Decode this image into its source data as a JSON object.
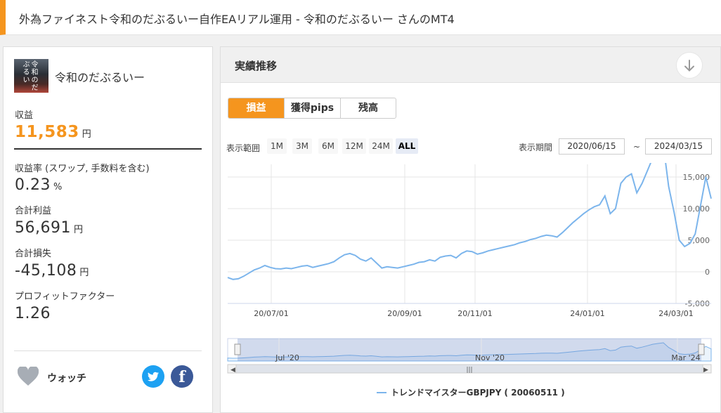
{
  "header": {
    "title": "外為ファイネスト令和のだぶるいー自作EAリアル運用 - 令和のだぶるいー さんのMT4"
  },
  "profile": {
    "name": "令和のだぶるいー",
    "avatar_text": "令和のだぶるい"
  },
  "stats": {
    "profit_label": "収益",
    "profit_value": "11,583",
    "yen": "円",
    "rate_label": "収益率 (スワップ, 手数料を含む)",
    "rate_value": "0.23",
    "percent": "%",
    "gross_profit_label": "合計利益",
    "gross_profit_value": "56,691",
    "gross_loss_label": "合計損失",
    "gross_loss_value": "-45,108",
    "pf_label": "プロフィットファクター",
    "pf_value": "1.26"
  },
  "watch": {
    "label": "ウォッチ",
    "icon": "heart-icon"
  },
  "social": {
    "twitter_icon": "twitter-icon",
    "facebook_icon": "facebook-icon",
    "facebook_glyph": "f"
  },
  "panel": {
    "title": "実績推移",
    "download_icon": "arrow-down-icon"
  },
  "tabs": [
    {
      "label": "損益",
      "active": true
    },
    {
      "label": "獲得pips",
      "active": false
    },
    {
      "label": "残高",
      "active": false
    }
  ],
  "range": {
    "label": "表示範囲",
    "buttons": [
      "1M",
      "3M",
      "6M",
      "12M",
      "24M",
      "ALL"
    ],
    "selected": "ALL",
    "period_label": "表示期間",
    "from": "2020/06/15",
    "tilde": "~",
    "to": "2024/03/15"
  },
  "colors": {
    "accent": "#f5951e",
    "line": "#7cb5ec",
    "navigator_fill": "#ccd6eb"
  },
  "chart_data": {
    "type": "line",
    "series": [
      {
        "name": "トレンドマイスターGBPJPY ( 20060511 )",
        "values": [
          -900,
          -1200,
          -1100,
          -700,
          -200,
          300,
          600,
          1000,
          700,
          500,
          450,
          600,
          500,
          700,
          900,
          1000,
          700,
          900,
          1100,
          1300,
          1600,
          2200,
          2700,
          2900,
          2600,
          2000,
          1700,
          2200,
          1400,
          600,
          800,
          700,
          600,
          800,
          1000,
          1200,
          1500,
          1600,
          1900,
          1700,
          2300,
          2500,
          2600,
          2200,
          2900,
          3300,
          3200,
          2800,
          3000,
          3300,
          3500,
          3700,
          3900,
          4100,
          4300,
          4600,
          4800,
          5100,
          5300,
          5600,
          5800,
          5700,
          5500,
          6200,
          7000,
          7800,
          8500,
          9200,
          9800,
          10300,
          10600,
          12000,
          9200,
          10000,
          14000,
          15000,
          15500,
          12500,
          14000,
          16000,
          18000,
          19000,
          20000,
          13500,
          9500,
          5000,
          4000,
          4500,
          6000,
          10500,
          15000,
          11583
        ],
        "values_note_ignored": false
      }
    ],
    "x_ticks": [
      "20/07/01",
      "20/09/01",
      "20/11/01",
      "24/01/01",
      "24/03/01"
    ],
    "y_ticks": [
      "15,000",
      "10,000",
      "5,000",
      "0",
      "-5,000"
    ],
    "ylim": [
      -5000,
      17000
    ],
    "navigator_ticks": [
      "Jul '20",
      "Nov '20",
      "Mar '24"
    ],
    "legend": "トレンドマイスターGBPJPY ( 20060511 )",
    "grid": true
  }
}
